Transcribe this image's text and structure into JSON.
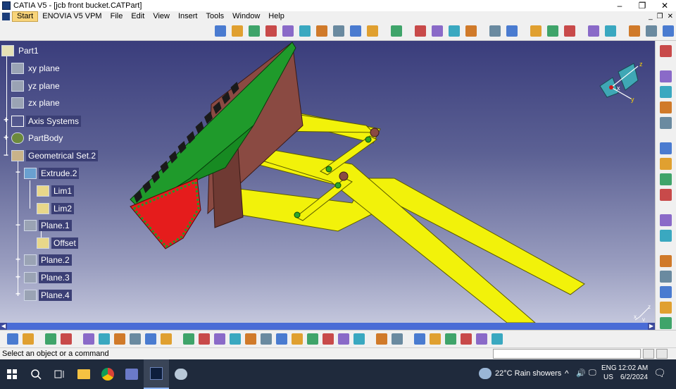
{
  "window": {
    "title": "CATIA V5 - [jcb front bucket.CATPart]",
    "controls": [
      "–",
      "❐",
      "✕"
    ],
    "doc_controls": [
      "_",
      "❐",
      "✕"
    ]
  },
  "menu": {
    "items": [
      "Start",
      "ENOVIA V5 VPM",
      "File",
      "Edit",
      "View",
      "Insert",
      "Tools",
      "Window",
      "Help"
    ]
  },
  "tree": {
    "root": "Part1",
    "nodes": [
      {
        "label": "xy plane"
      },
      {
        "label": "yz plane"
      },
      {
        "label": "zx plane"
      },
      {
        "label": "Axis Systems"
      },
      {
        "label": "PartBody"
      },
      {
        "label": "Geometrical Set.2"
      },
      {
        "label": "Extrude.2"
      },
      {
        "label": "Lim1"
      },
      {
        "label": "Lim2"
      },
      {
        "label": "Plane.1"
      },
      {
        "label": "Offset"
      },
      {
        "label": "Plane.2"
      },
      {
        "label": "Plane.3"
      },
      {
        "label": "Plane.4"
      }
    ]
  },
  "compass": {
    "axis_x": "x",
    "axis_y": "y",
    "axis_z": "z"
  },
  "triad": {
    "axis_x": "x",
    "axis_y": "y",
    "axis_z": "z"
  },
  "statusbar": {
    "message": "Select an object or a command",
    "command_input": ""
  },
  "taskbar": {
    "weather": "22°C  Rain showers",
    "lang": "ENG",
    "region": "US",
    "time": "12:02 AM",
    "date": "6/2/2024"
  },
  "colors": {
    "viewport_top": "#3a3d7c",
    "viewport_bottom": "#c3c6dc",
    "bucket_green": "#1f9a2b",
    "bucket_side": "#e51c1c",
    "bucket_back": "#8a4a42",
    "arm_yellow": "#f2f20a",
    "teeth": "#1a1a1a"
  },
  "icons": {
    "top_toolbar": [
      "sketch-icon",
      "sketch-position-icon",
      "pad-icon",
      "pocket-icon",
      "shaft-icon",
      "groove-icon",
      "rib-icon",
      "slot-icon",
      "stiffener-icon",
      "multi-section-icon",
      "measure-icon",
      "fillet-icon",
      "chamfer-icon",
      "draft-icon",
      "shell-icon",
      "thickness-icon",
      "thread-icon",
      "hole-icon",
      "split-icon",
      "thick-surface-icon",
      "close-surface-icon",
      "sew-surface-icon",
      "boolean-icon",
      "point-icon",
      "line-icon",
      "plane-icon"
    ],
    "right_toolbar": [
      "gear-icon",
      "axis-icon",
      "plane-icon",
      "projection-icon",
      "intersection-icon",
      "select-arrow-icon",
      "constraint-icon",
      "analysis-icon",
      "grid-icon",
      "snap-icon",
      "annotation-icon",
      "view-icon",
      "material-icon",
      "catalog-icon",
      "knowledge-icon",
      "formula-icon"
    ],
    "bottom_toolbar": [
      "new-icon",
      "open-icon",
      "save-icon",
      "print-icon",
      "cut-icon",
      "copy-icon",
      "paste-icon",
      "undo-icon",
      "redo-icon",
      "whats-this-icon",
      "fly-icon",
      "fit-all-icon",
      "pan-icon",
      "rotate-icon",
      "zoom-in-icon",
      "zoom-out-icon",
      "normal-view-icon",
      "iso-view-icon",
      "view-mode-icon",
      "hide-show-icon",
      "swap-visible-icon",
      "multi-view-icon",
      "table-icon",
      "fog-icon",
      "update-icon",
      "apply-material-icon",
      "scale-icon",
      "stack-icon",
      "measure-between-icon",
      "eraser-icon"
    ]
  }
}
